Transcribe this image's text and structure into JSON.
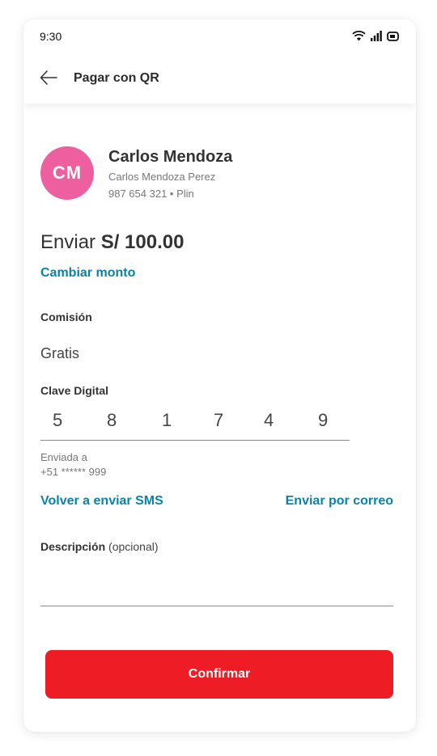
{
  "status_bar": {
    "time": "9:30"
  },
  "app_bar": {
    "title": "Pagar con QR",
    "back_icon": "arrow-left-icon"
  },
  "contact": {
    "initials": "CM",
    "avatar_color": "#ee5fa0",
    "name": "Carlos Mendoza",
    "full_name": "Carlos Mendoza Perez",
    "phone_line": "987 654 321 • Plin"
  },
  "amount": {
    "prefix": "Enviar",
    "value": "S/ 100.00",
    "change_label": "Cambiar monto"
  },
  "commission": {
    "label": "Comisión",
    "value": "Gratis"
  },
  "digital_key": {
    "label": "Clave Digital",
    "digits": [
      "5",
      "8",
      "1",
      "7",
      "4",
      "9"
    ],
    "sent_to_label": "Enviada a",
    "sent_to_number": "+51 ****** 999",
    "resend_sms_label": "Volver a enviar SMS",
    "send_email_label": "Enviar por correo"
  },
  "description": {
    "label": "Descripción",
    "optional": "(opcional)",
    "value": ""
  },
  "confirm_button": {
    "label": "Confirmar",
    "color": "#ee1c25"
  },
  "colors": {
    "link": "#0a83a8"
  }
}
